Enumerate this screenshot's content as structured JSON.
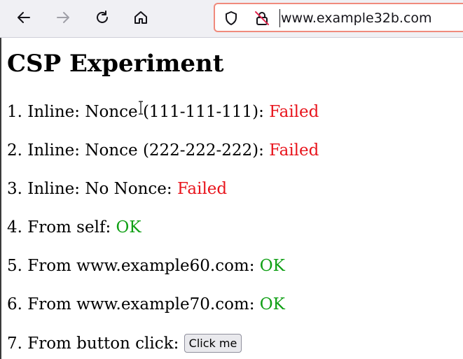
{
  "browser": {
    "url": "www.example32b.com",
    "icons": {
      "back": "arrow-left-icon",
      "forward": "arrow-right-icon",
      "reload": "reload-icon",
      "home": "home-icon",
      "shield": "shield-icon",
      "lock": "insecure-lock-icon"
    }
  },
  "page": {
    "title": "CSP Experiment",
    "items": [
      {
        "label": "1. Inline: Nonce (111-111-111): ",
        "status": "Failed"
      },
      {
        "label": "2. Inline: Nonce (222-222-222): ",
        "status": "Failed"
      },
      {
        "label": "3. Inline: No Nonce: ",
        "status": "Failed"
      },
      {
        "label": "4. From self: ",
        "status": "OK"
      },
      {
        "label": "5. From www.example60.com: ",
        "status": "OK"
      },
      {
        "label": "6. From www.example70.com: ",
        "status": "OK"
      },
      {
        "label": "7. From button click: ",
        "button": "Click me"
      }
    ]
  },
  "colors": {
    "failed": "#e8141c",
    "ok": "#10a015",
    "urlbar_border": "#f08a7c"
  }
}
